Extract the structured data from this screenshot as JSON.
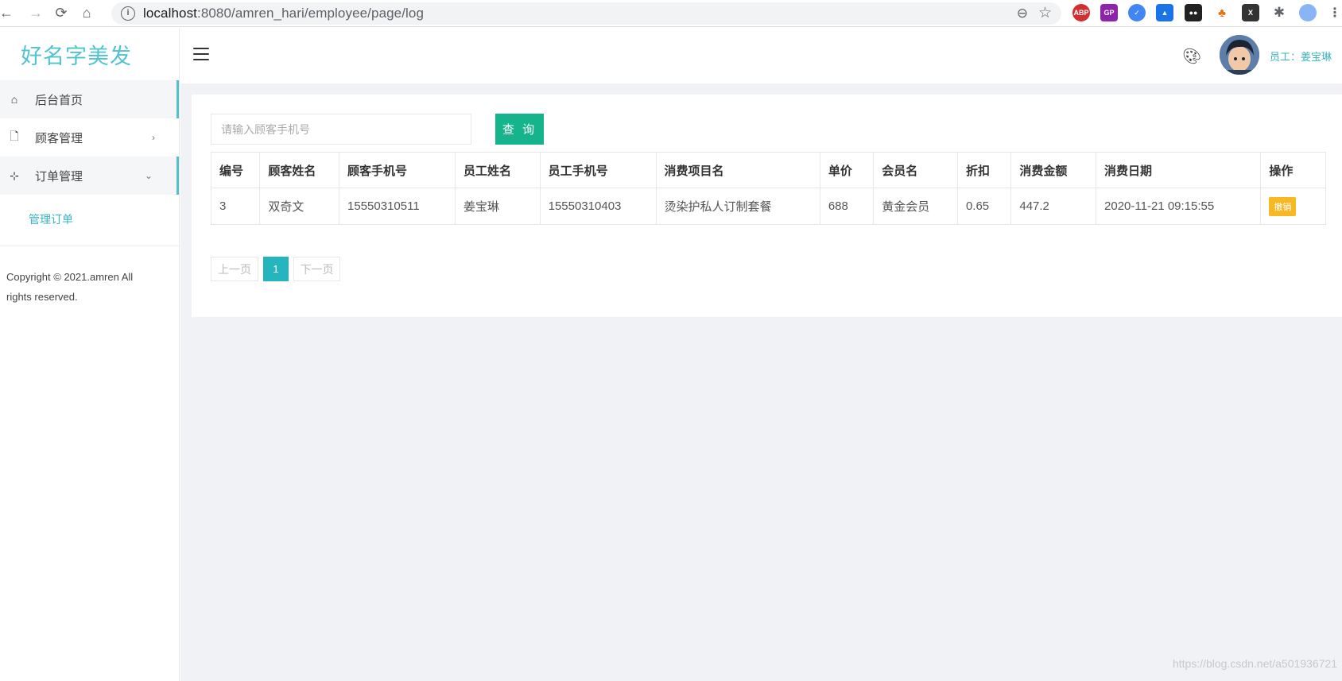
{
  "browser": {
    "url_host": "localhost",
    "url_path": ":8080/amren_hari/employee/page/log",
    "extensions": [
      "ABP",
      "GP",
      "",
      "",
      "",
      "",
      "X",
      "",
      ""
    ]
  },
  "sidebar": {
    "logo": "好名字美发",
    "items": [
      {
        "label": "后台首页",
        "icon": "home-icon"
      },
      {
        "label": "顾客管理",
        "icon": "file-icon"
      },
      {
        "label": "订单管理",
        "icon": "tree-icon"
      }
    ],
    "subitems": [
      {
        "label": "管理订单"
      }
    ],
    "copyright": "Copyright © 2021.amren All rights reserved."
  },
  "header": {
    "user_label": "员工：姜宝琳"
  },
  "search": {
    "placeholder": "请输入顾客手机号",
    "button_label": "查 询"
  },
  "table": {
    "headers": [
      "编号",
      "顾客姓名",
      "顾客手机号",
      "员工姓名",
      "员工手机号",
      "消费项目名",
      "单价",
      "会员名",
      "折扣",
      "消费金额",
      "消费日期",
      "操作"
    ],
    "rows": [
      {
        "id": "3",
        "customer_name": "双奇文",
        "customer_phone": "15550310511",
        "employee_name": "姜宝琳",
        "employee_phone": "15550310403",
        "project": "烫染护私人订制套餐",
        "price": "688",
        "member": "黄金会员",
        "discount": "0.65",
        "amount": "447.2",
        "date": "2020-11-21 09:15:55",
        "action": "撤销"
      }
    ]
  },
  "pager": {
    "prev": "上一页",
    "current": "1",
    "next": "下一页"
  },
  "watermark": "https://blog.csdn.net/a501936721",
  "colors": {
    "accent": "#4fc3d0",
    "query_button": "#16b48c",
    "revoke_button": "#f7b824",
    "page_active": "#25b5bf"
  }
}
